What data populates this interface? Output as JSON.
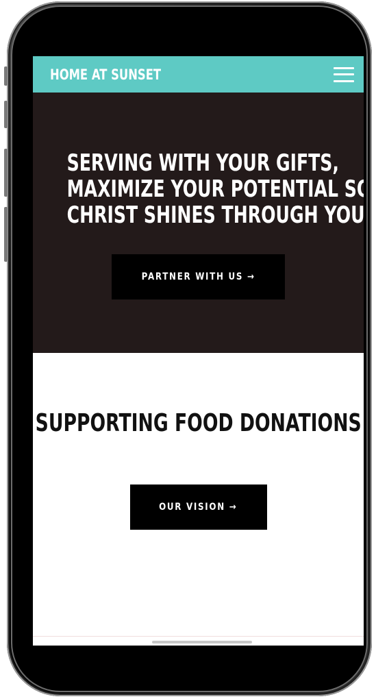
{
  "navbar": {
    "brand": "HOME AT SUNSET",
    "menu_icon": "hamburger-menu-icon"
  },
  "hero": {
    "title_lines": [
      "SERVING WITH YOUR GIFTS,",
      "MAXIMIZE YOUR POTENTIAL SO",
      "CHRIST SHINES THROUGH YOU."
    ],
    "button_label": "PARTNER WITH US →"
  },
  "section": {
    "title": "SUPPORTING FOOD DONATIONS",
    "button_label": "OUR VISION →"
  },
  "colors": {
    "navbar_bg": "#5ecac4",
    "hero_bg": "#231a1a",
    "button_bg": "#000000",
    "text_light": "#ffffff",
    "text_dark": "#111111"
  }
}
